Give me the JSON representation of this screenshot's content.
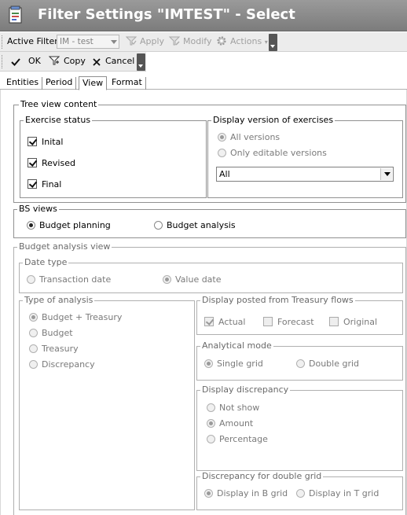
{
  "window": {
    "title": "Filter Settings \"IMTEST\" - Select"
  },
  "toolbar1": {
    "active_filter_label": "Active Filter",
    "active_filter_value": "IM - test",
    "apply_label": "Apply",
    "modify_label": "Modify",
    "actions_label": "Actions"
  },
  "toolbar2": {
    "ok_label": "OK",
    "copy_label": "Copy",
    "cancel_label": "Cancel"
  },
  "tabs": [
    "Entities",
    "Period",
    "View",
    "Format"
  ],
  "active_tab": "View",
  "tree_view": {
    "label": "Tree view content",
    "exercise_status": {
      "label": "Exercise status",
      "items": [
        {
          "label": "Inital",
          "checked": true
        },
        {
          "label": "Revised",
          "checked": true
        },
        {
          "label": "Final",
          "checked": true
        }
      ]
    },
    "display_version": {
      "label": "Display version of exercises",
      "options": [
        "All versions",
        "Only editable versions"
      ],
      "selected": "All versions",
      "dropdown_value": "All"
    }
  },
  "bs_views": {
    "label": "BS views",
    "options": [
      "Budget planning",
      "Budget analysis"
    ],
    "selected": "Budget planning"
  },
  "budget_analysis": {
    "label": "Budget analysis view",
    "date_type": {
      "label": "Date type",
      "options": [
        "Transaction date",
        "Value date"
      ],
      "selected": "Value date"
    },
    "type_of_analysis": {
      "label": "Type of analysis",
      "options": [
        "Budget + Treasury",
        "Budget",
        "Treasury",
        "Discrepancy"
      ],
      "selected": "Budget + Treasury"
    },
    "posted_from_treasury": {
      "label": "Display posted from Treasury flows",
      "items": [
        {
          "label": "Actual",
          "checked": true
        },
        {
          "label": "Forecast",
          "checked": false
        },
        {
          "label": "Original",
          "checked": false
        }
      ]
    },
    "analytical_mode": {
      "label": "Analytical mode",
      "options": [
        "Single grid",
        "Double grid"
      ],
      "selected": "Single grid"
    },
    "display_discrepancy": {
      "label": "Display discrepancy",
      "options": [
        "Not show",
        "Amount",
        "Percentage"
      ],
      "selected": "Amount"
    },
    "discrepancy_double_grid": {
      "label": "Discrepancy for double grid",
      "options": [
        "Display in B grid",
        "Display in T grid"
      ],
      "selected": "Display in B grid"
    }
  }
}
